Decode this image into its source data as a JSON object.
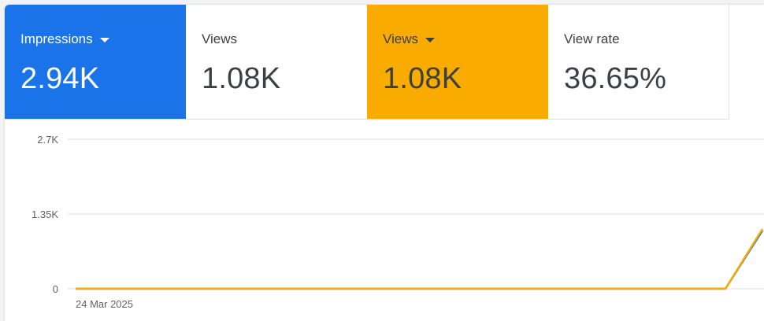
{
  "metrics": [
    {
      "label": "Impressions",
      "value": "2.94K",
      "selected": true,
      "has_dropdown": true,
      "color": "#1a73e8"
    },
    {
      "label": "Views",
      "value": "1.08K",
      "selected": false,
      "has_dropdown": false
    },
    {
      "label": "Views",
      "value": "1.08K",
      "selected": true,
      "has_dropdown": true,
      "color": "#f9ab00"
    },
    {
      "label": "View rate",
      "value": "36.65%",
      "selected": false,
      "has_dropdown": false
    }
  ],
  "chart_data": {
    "type": "line",
    "x": [
      "24 Mar 2025"
    ],
    "x_tick_labels": [
      "24 Mar 2025"
    ],
    "ylim": [
      0,
      2700
    ],
    "y_tick_labels": [
      "2.7K",
      "1.35K",
      "0"
    ],
    "y_ticks": [
      2700,
      1350,
      0
    ],
    "grid": true,
    "series": [
      {
        "color": "#1a73e8",
        "values": [
          0,
          0,
          0,
          0,
          0,
          0,
          0,
          0,
          0,
          0,
          1050
        ]
      },
      {
        "color": "#f9ab00",
        "values": [
          0,
          0,
          0,
          0,
          0,
          0,
          0,
          0,
          0,
          0,
          1080
        ]
      }
    ]
  },
  "colors": {
    "blue": "#1a73e8",
    "yellow": "#f9ab00",
    "grid": "#dadce0"
  }
}
